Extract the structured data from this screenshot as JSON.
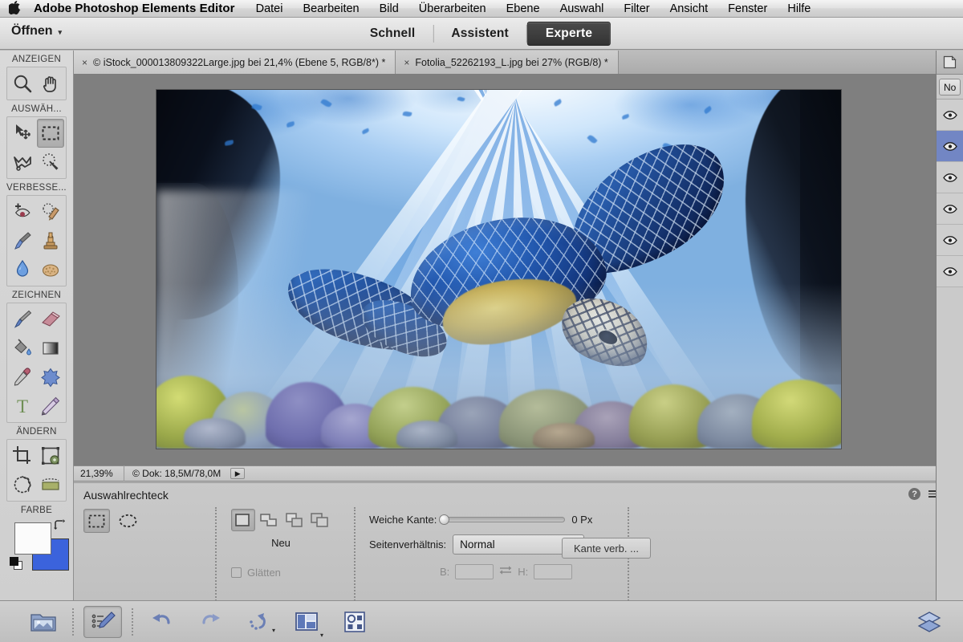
{
  "menubar": {
    "apple_icon": "apple-logo",
    "app_title": "Adobe Photoshop Elements Editor",
    "items": [
      {
        "label": "Datei"
      },
      {
        "label": "Bearbeiten"
      },
      {
        "label": "Bild"
      },
      {
        "label": "Überarbeiten"
      },
      {
        "label": "Ebene"
      },
      {
        "label": "Auswahl"
      },
      {
        "label": "Filter"
      },
      {
        "label": "Ansicht"
      },
      {
        "label": "Fenster"
      },
      {
        "label": "Hilfe"
      }
    ]
  },
  "modebar": {
    "open_label": "Öffnen",
    "open_caret": "▾",
    "tabs": [
      {
        "label": "Schnell",
        "active": false
      },
      {
        "label": "Assistent",
        "active": false
      },
      {
        "label": "Experte",
        "active": true
      }
    ]
  },
  "toolbar": {
    "sections": [
      {
        "label": "ANZEIGEN",
        "tools": [
          {
            "name": "zoom-tool",
            "icon": "magnifier-icon",
            "selected": false
          },
          {
            "name": "hand-tool",
            "icon": "hand-icon",
            "selected": false
          }
        ]
      },
      {
        "label": "AUSWÄH...",
        "tools": [
          {
            "name": "move-tool",
            "icon": "move-arrow-icon",
            "selected": false
          },
          {
            "name": "rectangular-marquee-tool",
            "icon": "marquee-rect-icon",
            "selected": true
          },
          {
            "name": "lasso-tool",
            "icon": "lasso-icon",
            "selected": false
          },
          {
            "name": "magic-wand-tool",
            "icon": "magic-wand-icon",
            "selected": false
          }
        ]
      },
      {
        "label": "VERBESSE...",
        "tools": [
          {
            "name": "red-eye-tool",
            "icon": "red-eye-icon",
            "selected": false
          },
          {
            "name": "spot-healing-tool",
            "icon": "healing-brush-icon",
            "selected": false
          },
          {
            "name": "smart-brush-tool",
            "icon": "smart-brush-icon",
            "selected": false
          },
          {
            "name": "clone-stamp-tool",
            "icon": "stamp-icon",
            "selected": false
          },
          {
            "name": "blur-tool",
            "icon": "waterdrop-icon",
            "selected": false
          },
          {
            "name": "sponge-tool",
            "icon": "sponge-icon",
            "selected": false
          }
        ]
      },
      {
        "label": "ZEICHNEN",
        "tools": [
          {
            "name": "brush-tool",
            "icon": "paintbrush-icon",
            "selected": false
          },
          {
            "name": "eraser-tool",
            "icon": "eraser-icon",
            "selected": false
          },
          {
            "name": "paint-bucket-tool",
            "icon": "paint-bucket-icon",
            "selected": false
          },
          {
            "name": "gradient-tool",
            "icon": "gradient-icon",
            "selected": false
          },
          {
            "name": "eyedropper-tool",
            "icon": "eyedropper-icon",
            "selected": false
          },
          {
            "name": "custom-shape-tool",
            "icon": "star-shape-icon",
            "selected": false
          },
          {
            "name": "type-tool",
            "icon": "type-T-icon",
            "selected": false
          },
          {
            "name": "pencil-tool",
            "icon": "pencil-icon",
            "selected": false
          }
        ]
      },
      {
        "label": "ÄNDERN",
        "tools": [
          {
            "name": "crop-tool",
            "icon": "crop-icon",
            "selected": false
          },
          {
            "name": "recompose-tool",
            "icon": "recompose-icon",
            "selected": false
          },
          {
            "name": "cookie-cutter-tool",
            "icon": "cookie-cutter-icon",
            "selected": false
          },
          {
            "name": "straighten-tool",
            "icon": "straighten-icon",
            "selected": false
          }
        ]
      }
    ],
    "color_section_label": "FARBE",
    "foreground_color": "#fbfbfb",
    "background_color": "#3b63dc"
  },
  "doc_tabs": [
    {
      "close": "×",
      "label": "© iStock_000013809322Large.jpg bei 21,4% (Ebene 5, RGB/8*) *",
      "active": true
    },
    {
      "close": "×",
      "label": "Fotolia_52262193_L.jpg bei 27% (RGB/8) *",
      "active": false
    }
  ],
  "statusbar": {
    "zoom": "21,39%",
    "doc_info": "© Dok: 18,5M/78,0M",
    "expand_arrow": "▶"
  },
  "options": {
    "title": "Auswahlrechteck",
    "shape_buttons": [
      {
        "name": "rectangular-marquee-option",
        "icon": "marquee-rect-icon",
        "selected": true
      },
      {
        "name": "elliptical-marquee-option",
        "icon": "marquee-ellipse-icon",
        "selected": false
      }
    ],
    "bool_buttons": [
      {
        "name": "new-selection",
        "icon": "selection-new-icon",
        "selected": true
      },
      {
        "name": "add-to-selection",
        "icon": "selection-add-icon",
        "selected": false
      },
      {
        "name": "subtract-from-selection",
        "icon": "selection-subtract-icon",
        "selected": false
      },
      {
        "name": "intersect-selection",
        "icon": "selection-intersect-icon",
        "selected": false
      }
    ],
    "bool_label": "Neu",
    "antialias_label": "Glätten",
    "antialias_checked": false,
    "feather_label": "Weiche Kante:",
    "feather_value": "0 Px",
    "feather_slider_pct": 0,
    "aspect_label": "Seitenverhältnis:",
    "aspect_value": "Normal",
    "aspect_caret": "▼",
    "width_label": "B:",
    "width_value": "",
    "swap_icon": "swap-arrows-icon",
    "height_label": "H:",
    "height_value": "",
    "refine_edge_label": "Kante verb. ...",
    "help_icon": "help-question-icon",
    "menu_icon": "panel-menu-icon",
    "collapse_icon": "chevron-down-icon"
  },
  "right_panel": {
    "tab_icon": "layers-panel-icon",
    "blend_mode": "No",
    "layers": [
      {
        "name": "layer-row-1",
        "visible": true,
        "active": false
      },
      {
        "name": "layer-row-2",
        "visible": true,
        "active": true
      },
      {
        "name": "layer-row-3",
        "visible": true,
        "active": false
      },
      {
        "name": "layer-row-4",
        "visible": true,
        "active": false
      },
      {
        "name": "layer-row-5",
        "visible": true,
        "active": false
      },
      {
        "name": "layer-row-6",
        "visible": true,
        "active": false
      }
    ]
  },
  "taskbar": {
    "buttons": [
      {
        "name": "photo-bin-button",
        "icon": "photo-bin-icon",
        "selected": false,
        "caret": false
      },
      {
        "name": "tool-options-button",
        "icon": "tool-options-icon",
        "selected": true,
        "caret": false
      },
      {
        "name": "undo-button",
        "icon": "undo-arrow-icon",
        "selected": false,
        "caret": false
      },
      {
        "name": "redo-button",
        "icon": "redo-arrow-icon",
        "selected": false,
        "caret": false
      },
      {
        "name": "rotate-button",
        "icon": "rotate-icon",
        "selected": false,
        "caret": true
      },
      {
        "name": "layout-button",
        "icon": "layout-grid-icon",
        "selected": false,
        "caret": true
      },
      {
        "name": "organizer-button",
        "icon": "organizer-icon",
        "selected": false,
        "caret": false
      }
    ],
    "right_button": {
      "name": "layers-button",
      "icon": "layers-stack-icon"
    }
  },
  "canvas": {
    "artwork_name": "underwater-sea-turtle-photo",
    "description": "Unterwasserszene mit Meeresschildkröte, Lichtstrahlen und Korallenriff"
  }
}
